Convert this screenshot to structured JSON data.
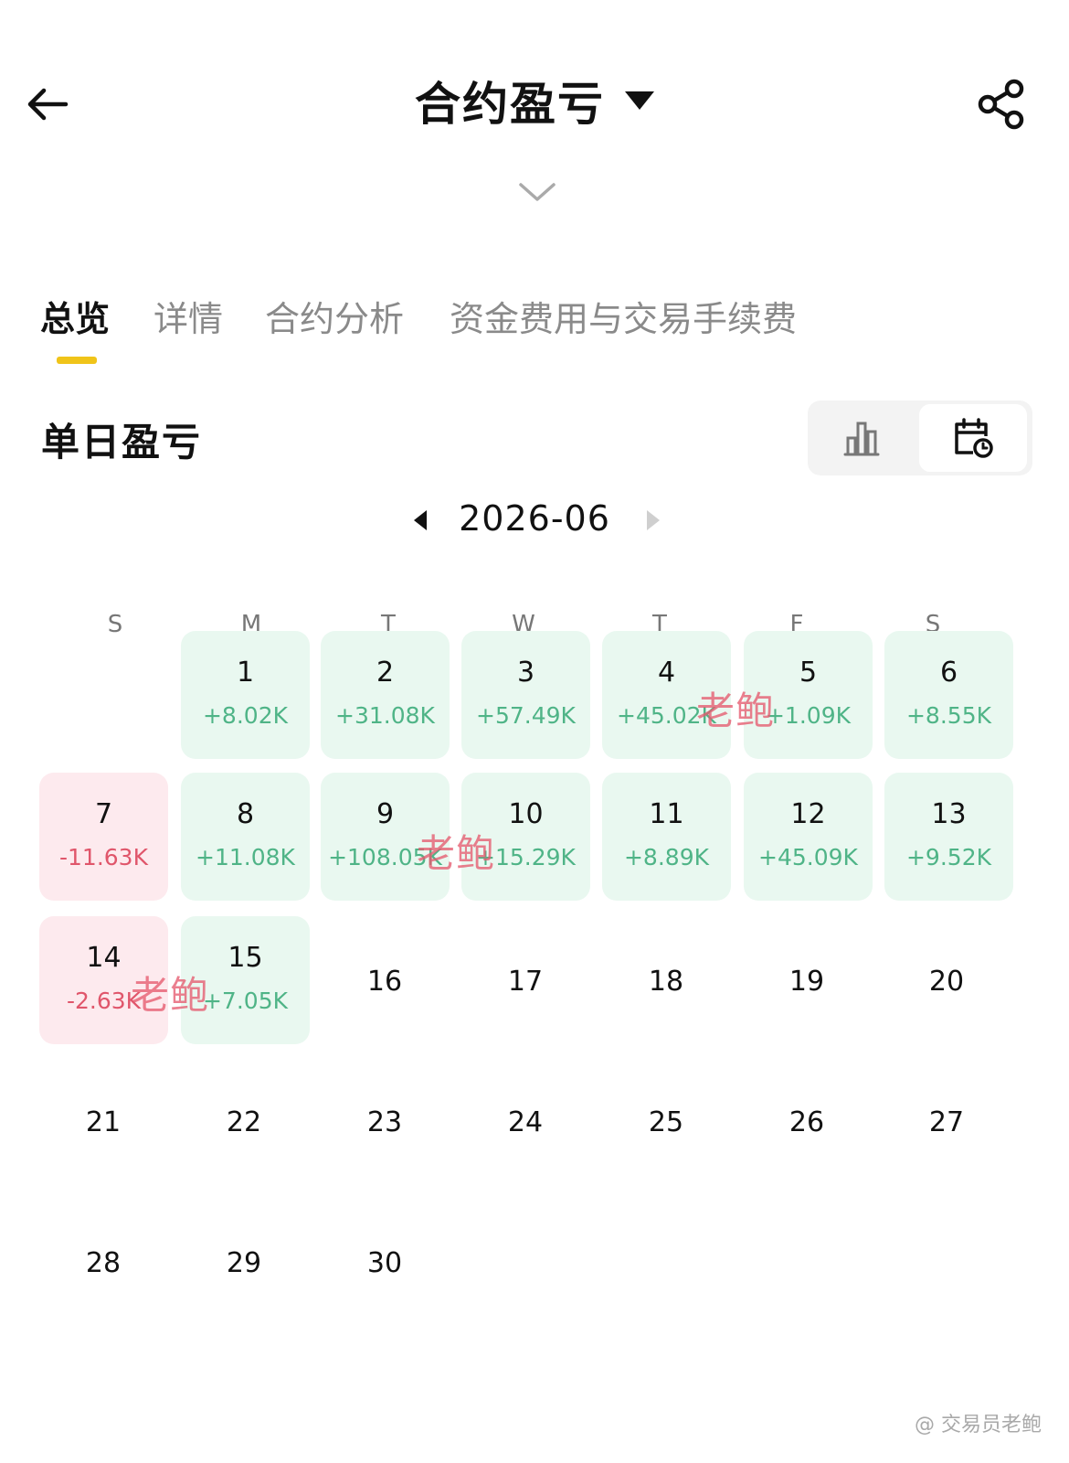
{
  "header": {
    "title": "合约盈亏"
  },
  "tabs": [
    {
      "label": "总览",
      "active": true
    },
    {
      "label": "详情",
      "active": false
    },
    {
      "label": "合约分析",
      "active": false
    },
    {
      "label": "资金费用与交易手续费",
      "active": false
    }
  ],
  "section": {
    "title": "单日盈亏",
    "view_options": [
      "bar-chart-icon",
      "calendar-clock-icon"
    ],
    "selected_view": "calendar-clock-icon"
  },
  "calendar": {
    "month": "2026-06",
    "weekdays": [
      "S",
      "M",
      "T",
      "W",
      "T",
      "F",
      "S"
    ],
    "days": [
      {
        "day": "1",
        "pnl": "+8.02K"
      },
      {
        "day": "2",
        "pnl": "+31.08K"
      },
      {
        "day": "3",
        "pnl": "+57.49K"
      },
      {
        "day": "4",
        "pnl": "+45.02K"
      },
      {
        "day": "5",
        "pnl": "+1.09K"
      },
      {
        "day": "6",
        "pnl": "+8.55K"
      },
      {
        "day": "7",
        "pnl": "-11.63K"
      },
      {
        "day": "8",
        "pnl": "+11.08K"
      },
      {
        "day": "9",
        "pnl": "+108.05K"
      },
      {
        "day": "10",
        "pnl": "+15.29K"
      },
      {
        "day": "11",
        "pnl": "+8.89K"
      },
      {
        "day": "12",
        "pnl": "+45.09K"
      },
      {
        "day": "13",
        "pnl": "+9.52K"
      },
      {
        "day": "14",
        "pnl": "-2.63K"
      },
      {
        "day": "15",
        "pnl": "+7.05K"
      },
      {
        "day": "16"
      },
      {
        "day": "17"
      },
      {
        "day": "18"
      },
      {
        "day": "19"
      },
      {
        "day": "20"
      },
      {
        "day": "21"
      },
      {
        "day": "22"
      },
      {
        "day": "23"
      },
      {
        "day": "24"
      },
      {
        "day": "25"
      },
      {
        "day": "26"
      },
      {
        "day": "27"
      },
      {
        "day": "28"
      },
      {
        "day": "29"
      },
      {
        "day": "30"
      }
    ]
  },
  "watermarks": {
    "overlay": "老鲍",
    "footer": "@ 交易员老鲍"
  },
  "colors": {
    "accent": "#f0c419",
    "profit_text": "#4fb487",
    "profit_bg": "#e9f8f0",
    "loss_text": "#e0566b",
    "loss_bg": "#fdeaee"
  }
}
